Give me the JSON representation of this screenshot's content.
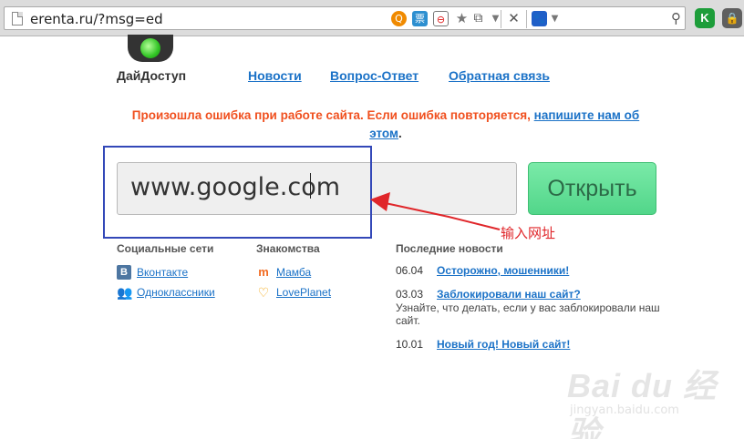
{
  "browser": {
    "url": "erenta.ru/?msg=ed",
    "icons": [
      "page-icon",
      "qipu-icon",
      "ticket-icon",
      "adblock-icon",
      "star-icon",
      "extension-icon",
      "chevron-down-icon",
      "close-icon",
      "paw-icon",
      "chevron-down-icon",
      "search-icon",
      "k-extension-icon",
      "lock-icon"
    ],
    "ticket_glyph": "票",
    "k_label": "K"
  },
  "site": {
    "logo_text": "ДайДоступ",
    "nav": [
      "Новости",
      "Вопрос-Ответ",
      "Обратная связь"
    ],
    "error_text": "Произошла ошибка при работе сайта. Если ошибка повторяется,",
    "error_link": "напишите нам об этом",
    "error_end": ".",
    "input_value": "www.google.com",
    "open_button": "Открыть"
  },
  "annotation": {
    "label": "输入网址",
    "color": "#e0262a",
    "box_color": "#3348b8"
  },
  "social": {
    "title": "Социальные сети",
    "items": [
      {
        "label": "Вконтакте",
        "icon": "vk-icon"
      },
      {
        "label": "Одноклассники",
        "icon": "odnoklassniki-icon"
      }
    ]
  },
  "dating": {
    "title": "Знакомства",
    "items": [
      {
        "label": "Мамба",
        "icon": "mamba-icon"
      },
      {
        "label": "LovePlanet",
        "icon": "loveplanet-icon"
      }
    ]
  },
  "news": {
    "title": "Последние новости",
    "items": [
      {
        "date": "06.04",
        "title": "Осторожно, мошенники!",
        "desc": ""
      },
      {
        "date": "03.03",
        "title": "Заблокировали наш сайт?",
        "desc": "Узнайте, что делать, если у вас заблокировали наш сайт."
      },
      {
        "date": "10.01",
        "title": "Новый год! Новый сайт!",
        "desc": ""
      }
    ]
  },
  "watermark": {
    "logo": "Bai du 经验",
    "url": "jingyan.baidu.com"
  },
  "colors": {
    "accent_link": "#1b72c7",
    "error": "#f0501f",
    "button": "#52d68a"
  }
}
